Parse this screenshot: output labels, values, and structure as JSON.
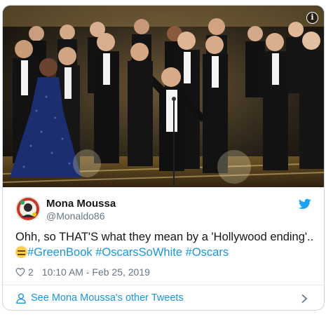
{
  "tweet": {
    "author_name": "Mona Moussa",
    "author_handle": "@Monaldo86",
    "text_main": "Ohh, so THAT'S what they mean by a 'Hollywood ending'..",
    "hashtags": [
      "#GreenBook",
      "#OscarsSoWhite",
      "#Oscars"
    ],
    "like_count": "2",
    "timestamp": "10:10 AM - Feb 25, 2019",
    "media_info_label": "i"
  },
  "footer": {
    "see_more_label": "See Mona Moussa's other Tweets"
  },
  "icons": {
    "brand": "twitter-bird-icon",
    "like": "heart-icon",
    "profile": "person-icon",
    "more": "chevron-right-icon",
    "info": "info-icon",
    "emoji": "expressionless-face-emoji"
  },
  "colors": {
    "link": "#1b95e0",
    "text": "#14171a",
    "muted": "#657786",
    "border": "#ccd6dd"
  }
}
